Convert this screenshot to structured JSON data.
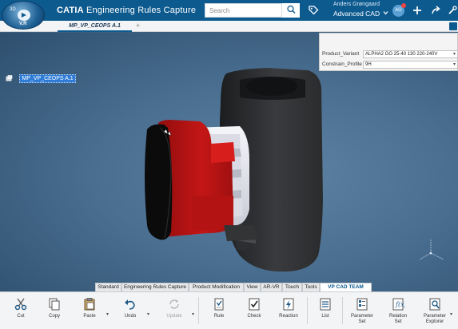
{
  "header": {
    "brand_version": "V.R",
    "compass_center": "3D",
    "compass_side": "3D",
    "app_name_bold": "CATIA",
    "app_name_rest": " Engineering Rules Capture",
    "search_placeholder": "Search",
    "user_name": "Anders Grøngaard",
    "role": "Advanced CAD",
    "avatar_initials": "AG",
    "colors": {
      "bar": "#0d5a8f",
      "accent": "#2f7cd6"
    }
  },
  "tabs": {
    "active": "MP_VP_CEOPS A.1",
    "add": "+"
  },
  "tree": {
    "root_label": "MP_VP_CEOPS A.1"
  },
  "parameters": [
    {
      "label": "Product_Variant",
      "value": "ALPHA2 GO 25-40 130 220-240V"
    },
    {
      "label": "Constrain_Profile",
      "value": "9H"
    }
  ],
  "section_tabs": [
    {
      "label": "Standard",
      "active": false
    },
    {
      "label": "Engineering Rules Capture",
      "active": false
    },
    {
      "label": "Product Modification",
      "active": false
    },
    {
      "label": "View",
      "active": false
    },
    {
      "label": "AR-VR",
      "active": false
    },
    {
      "label": "Touch",
      "active": false
    },
    {
      "label": "Tools",
      "active": false
    },
    {
      "label": "VP CAD TEAM TEST",
      "active": true
    }
  ],
  "tools": [
    {
      "label": "Cut",
      "icon": "scissors-icon",
      "enabled": true
    },
    {
      "label": "Copy",
      "icon": "copy-icon",
      "enabled": true
    },
    {
      "label": "Paste",
      "icon": "paste-icon",
      "enabled": true
    },
    {
      "label": "Undo",
      "icon": "undo-icon",
      "enabled": true
    },
    {
      "label": "Update",
      "icon": "update-icon",
      "enabled": false
    },
    {
      "label": "Rule",
      "icon": "rule-icon",
      "enabled": true
    },
    {
      "label": "Check",
      "icon": "check-icon",
      "enabled": true
    },
    {
      "label": "Reaction",
      "icon": "reaction-icon",
      "enabled": true
    },
    {
      "label": "List",
      "icon": "list-icon",
      "enabled": true
    },
    {
      "label": "Parameter\nSet",
      "icon": "parameter-set-icon",
      "enabled": true
    },
    {
      "label": "Relation\nSet",
      "icon": "relation-set-icon",
      "enabled": true
    },
    {
      "label": "Parameter\nExplorer",
      "icon": "parameter-explorer-icon",
      "enabled": true
    }
  ]
}
